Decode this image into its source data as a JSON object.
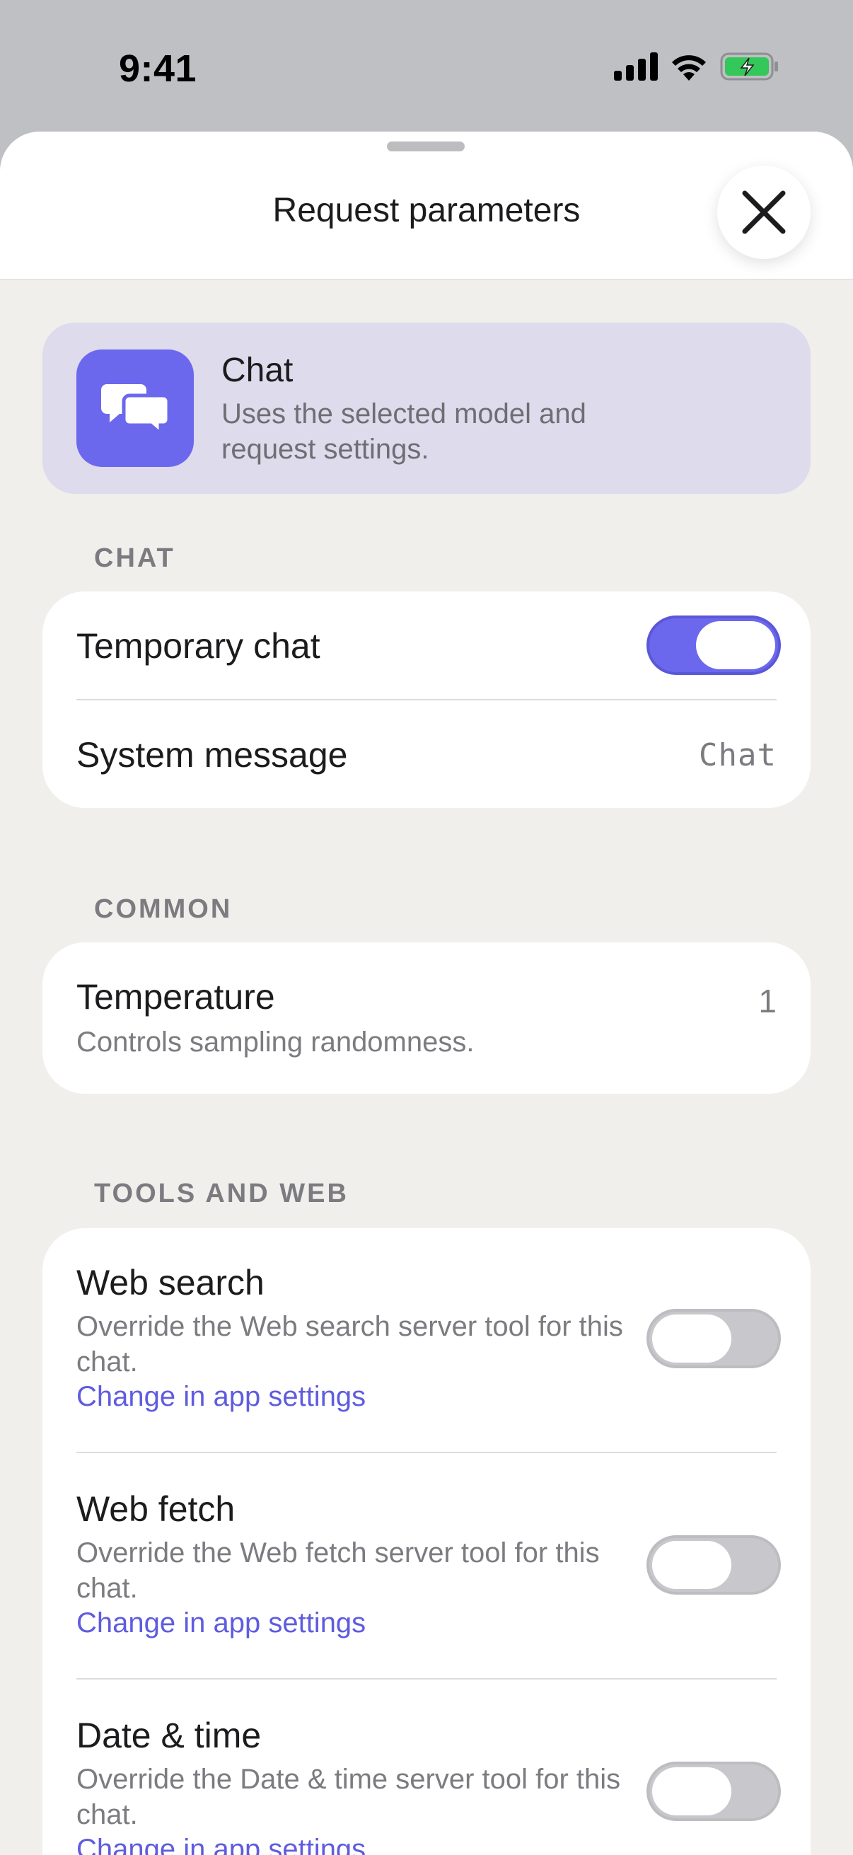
{
  "status_bar": {
    "time": "9:41"
  },
  "sheet": {
    "title": "Request parameters"
  },
  "mode_card": {
    "title": "Chat",
    "description": "Uses the selected model and request settings."
  },
  "sections": {
    "chat": {
      "label": "CHAT",
      "temporary_chat": {
        "label": "Temporary chat",
        "on": true
      },
      "system_message": {
        "label": "System message",
        "value": "Chat"
      }
    },
    "common": {
      "label": "COMMON",
      "temperature": {
        "label": "Temperature",
        "description": "Controls sampling randomness.",
        "value": "1"
      }
    },
    "tools": {
      "label": "TOOLS AND WEB",
      "items": [
        {
          "label": "Web search",
          "description": "Override the Web search server tool for this chat.",
          "link": "Change in app settings",
          "on": false
        },
        {
          "label": "Web fetch",
          "description": "Override the Web fetch server tool for this chat.",
          "link": "Change in app settings",
          "on": false
        },
        {
          "label": "Date & time",
          "description": "Override the Date & time server tool for this chat.",
          "link": "Change in app settings",
          "on": false
        }
      ]
    }
  },
  "colors": {
    "accent": "#6b68ee",
    "link": "#5f5cdf",
    "sheet_bg": "#f0efec",
    "mode_card_bg": "#dddbec"
  },
  "icons": {
    "close": "close-icon",
    "mode": "chat-bubbles-icon",
    "signal": "cellular-signal-icon",
    "wifi": "wifi-icon",
    "battery": "battery-charging-icon"
  }
}
